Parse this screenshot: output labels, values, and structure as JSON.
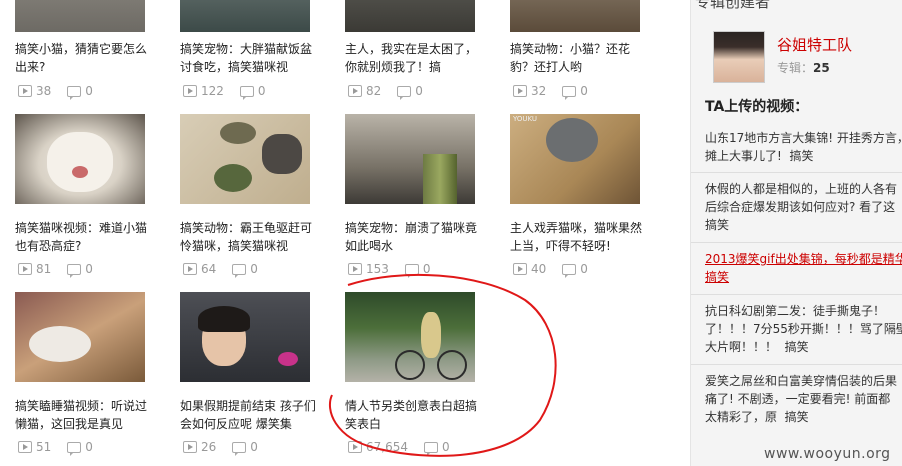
{
  "grid": [
    {
      "title": "搞笑小猫，猜猜它要怎么出来?",
      "views": "38",
      "comments": "0"
    },
    {
      "title": "搞笑宠物：大胖猫献饭盆讨食吃，搞笑猫咪视",
      "views": "122",
      "comments": "0"
    },
    {
      "title": "主人，我实在是太困了，你就别烦我了！搞",
      "views": "82",
      "comments": "0"
    },
    {
      "title": "搞笑动物：小猫？还花豹？还打人哟",
      "views": "32",
      "comments": "0"
    },
    {
      "title": "搞笑猫咪视频：难道小猫也有恐高症?",
      "views": "81",
      "comments": "0"
    },
    {
      "title": "搞笑动物：霸王龟驱赶可怜猫咪，搞笑猫咪视",
      "views": "64",
      "comments": "0"
    },
    {
      "title": "搞笑宠物：崩溃了猫咪竟如此喝水",
      "views": "153",
      "comments": "0"
    },
    {
      "title": "主人戏弄猫咪，猫咪果然上当，吓得不轻呀!",
      "views": "40",
      "comments": "0"
    },
    {
      "title": "搞笑瞌睡猫视频：听说过懒猫，这回我是真见",
      "views": "51",
      "comments": "0"
    },
    {
      "title": "如果假期提前结束 孩子们会如何反应呢 爆笑集",
      "views": "26",
      "comments": "0"
    },
    {
      "title": "情人节另类创意表白超搞笑表白",
      "views": "67,654",
      "comments": "0"
    }
  ],
  "sidebar": {
    "top_partial": "专辑创建者",
    "author_name": "谷姐特工队",
    "album_label": "专辑：",
    "album_count": "25",
    "uploads_title": "TA上传的视频：",
    "videos": [
      {
        "line1": "山东17地市方言大集锦! 开挂秀方言，",
        "line2": "摊上大事儿了!",
        "tag": "搞笑"
      },
      {
        "line1": "休假的人都是相似的，上班的人各有",
        "line2": "后综合症爆发期该如何应对? 看了这",
        "line3": "搞笑"
      },
      {
        "line1": "2013爆笑gif出处集锦，每秒都是精华",
        "line2": "搞笑"
      },
      {
        "line1": "抗日科幻剧第二发：徒手撕鬼子！",
        "line2": "了！！！7分55秒开撕！！！骂了隔壁",
        "line3": "大片啊！！！",
        "tag": "搞笑"
      },
      {
        "line1": "爱笑之屌丝和白富美穿情侣装的后果",
        "line2": "痛了! 不剧透，一定要看完! 前面都",
        "line3": "太精彩了，原",
        "tag": "搞笑"
      }
    ]
  },
  "watermark": "www.wooyun.org",
  "colors": {
    "accent_red": "#cc0000",
    "annotation": "#e01818"
  }
}
